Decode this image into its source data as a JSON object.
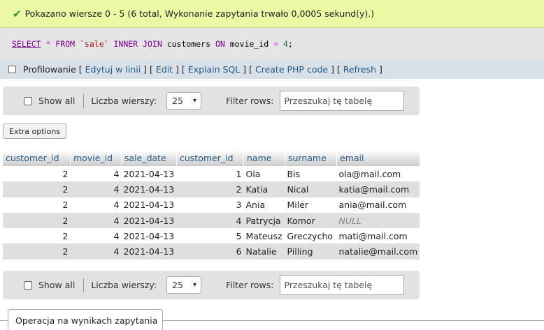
{
  "success": {
    "icon": "check-icon",
    "message": "Pokazano wiersze 0 - 5 (6 total, Wykonanie zapytania trwało 0,0005 sekund(y).)"
  },
  "sql": {
    "select": "SELECT",
    "star": "*",
    "from": "FROM",
    "table": "`sale`",
    "inner": "INNER",
    "join": "JOIN",
    "customers": "customers",
    "on": "ON",
    "col": "movie_id",
    "eq": "=",
    "val": "4",
    "semi": ";"
  },
  "links": {
    "profiling": "Profilowanie",
    "open": "[",
    "sep": "] [",
    "close": "]",
    "edit_inline": "Edytuj w linii",
    "edit": "Edit",
    "explain": "Explain SQL",
    "create_php": "Create PHP code",
    "refresh": "Refresh"
  },
  "nav": {
    "show_all": "Show all",
    "rows_label": "Liczba wierszy:",
    "rows_value": "25",
    "filter_label": "Filter rows:",
    "filter_placeholder": "Przeszukaj tę tabelę"
  },
  "extra_options": "Extra options",
  "table": {
    "headers": [
      "customer_id",
      "movie_id",
      "sale_date",
      "customer_id",
      "name",
      "surname",
      "email"
    ],
    "rows": [
      [
        "2",
        "4",
        "2021-04-13",
        "1",
        "Ola",
        "Bis",
        "ola@mail.com"
      ],
      [
        "2",
        "4",
        "2021-04-13",
        "2",
        "Katia",
        "Nical",
        "katia@mail.com"
      ],
      [
        "2",
        "4",
        "2021-04-13",
        "3",
        "Ania",
        "Miler",
        "ania@mail.com"
      ],
      [
        "2",
        "4",
        "2021-04-13",
        "4",
        "Patrycja",
        "Komor",
        "NULL"
      ],
      [
        "2",
        "4",
        "2021-04-13",
        "5",
        "Mateusz",
        "Greczycho",
        "mati@mail.com"
      ],
      [
        "2",
        "4",
        "2021-04-13",
        "6",
        "Natalie",
        "Pilling",
        "natalie@mail.com"
      ]
    ]
  },
  "operations_tab": "Operacja na wynikach zapytania"
}
